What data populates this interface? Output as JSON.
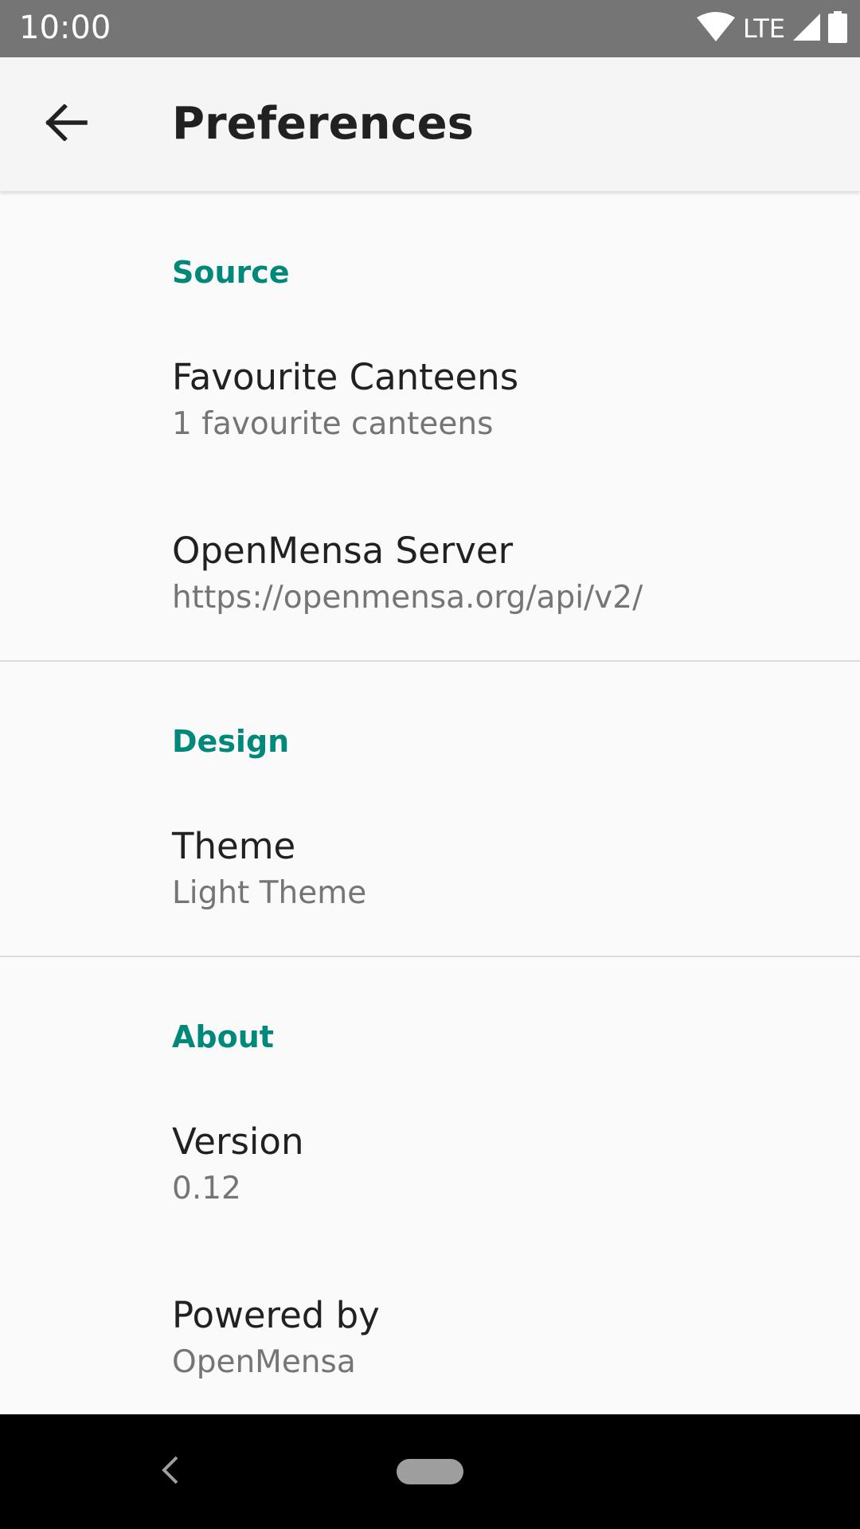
{
  "status_bar": {
    "time": "10:00",
    "network": "LTE",
    "icons": [
      "wifi-icon",
      "signal-icon",
      "battery-icon"
    ]
  },
  "app_bar": {
    "title": "Preferences",
    "back_icon": "arrow-back-icon"
  },
  "categories": [
    {
      "title": "Source",
      "items": [
        {
          "title": "Favourite Canteens",
          "summary": "1 favourite canteens"
        },
        {
          "title": "OpenMensa Server",
          "summary": "https://openmensa.org/api/v2/"
        }
      ]
    },
    {
      "title": "Design",
      "items": [
        {
          "title": "Theme",
          "summary": "Light Theme"
        }
      ]
    },
    {
      "title": "About",
      "items": [
        {
          "title": "Version",
          "summary": "0.12"
        },
        {
          "title": "Powered by",
          "summary": "OpenMensa"
        }
      ]
    }
  ],
  "colors": {
    "accent": "#00897b",
    "status_bar": "#757575",
    "app_bar": "#f5f5f5",
    "background": "#fafafa",
    "nav_bar": "#000000"
  }
}
